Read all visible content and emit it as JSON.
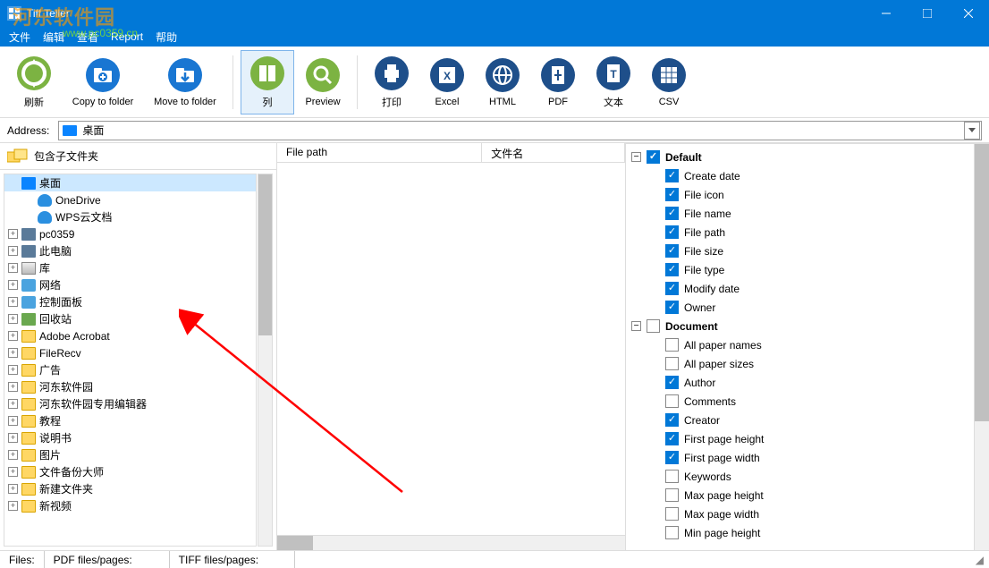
{
  "window": {
    "title": "Tiff Teller"
  },
  "menu": [
    "文件",
    "编辑",
    "查看",
    "Report",
    "帮助"
  ],
  "toolbar": [
    {
      "id": "refresh",
      "label": "刷新",
      "color": "#7cb342",
      "kind": "refresh"
    },
    {
      "id": "copyto",
      "label": "Copy to folder",
      "color": "#1976d2",
      "kind": "folder-plus",
      "wide": true
    },
    {
      "id": "moveto",
      "label": "Move to folder",
      "color": "#1976d2",
      "kind": "folder-down",
      "wide": true
    },
    {
      "sep": true
    },
    {
      "id": "columns",
      "label": "列",
      "color": "#7cb342",
      "kind": "columns",
      "active": true
    },
    {
      "id": "preview",
      "label": "Preview",
      "color": "#7cb342",
      "kind": "search"
    },
    {
      "sep": true
    },
    {
      "id": "print",
      "label": "打印",
      "color": "#1e4f8a",
      "kind": "print"
    },
    {
      "id": "excel",
      "label": "Excel",
      "color": "#1e4f8a",
      "kind": "xls"
    },
    {
      "id": "html",
      "label": "HTML",
      "color": "#1e4f8a",
      "kind": "html"
    },
    {
      "id": "pdf",
      "label": "PDF",
      "color": "#1e4f8a",
      "kind": "pdf"
    },
    {
      "id": "text",
      "label": "文本",
      "color": "#1e4f8a",
      "kind": "txt"
    },
    {
      "id": "csv",
      "label": "CSV",
      "color": "#1e4f8a",
      "kind": "csv"
    }
  ],
  "address": {
    "label": "Address:",
    "value": "桌面"
  },
  "left": {
    "subfolder_label": "包含子文件夹",
    "tree": [
      {
        "label": "桌面",
        "icon": "desktop",
        "selected": true,
        "depth": 0,
        "exp": ""
      },
      {
        "label": "OneDrive",
        "icon": "cloud",
        "depth": 1,
        "exp": ""
      },
      {
        "label": "WPS云文档",
        "icon": "cloud",
        "depth": 1,
        "exp": ""
      },
      {
        "label": "pc0359",
        "icon": "pc",
        "depth": 0,
        "exp": "+"
      },
      {
        "label": "此电脑",
        "icon": "pc",
        "depth": 0,
        "exp": "+"
      },
      {
        "label": "库",
        "icon": "drive",
        "depth": 0,
        "exp": "+"
      },
      {
        "label": "网络",
        "icon": "net",
        "depth": 0,
        "exp": "+"
      },
      {
        "label": "控制面板",
        "icon": "net",
        "depth": 0,
        "exp": "+"
      },
      {
        "label": "回收站",
        "icon": "recycle",
        "depth": 0,
        "exp": "+"
      },
      {
        "label": "Adobe Acrobat",
        "icon": "folder",
        "depth": 0,
        "exp": "+"
      },
      {
        "label": "FileRecv",
        "icon": "folder",
        "depth": 0,
        "exp": "+"
      },
      {
        "label": "广告",
        "icon": "folder",
        "depth": 0,
        "exp": "+"
      },
      {
        "label": "河东软件园",
        "icon": "folder",
        "depth": 0,
        "exp": "+"
      },
      {
        "label": "河东软件园专用编辑器",
        "icon": "folder",
        "depth": 0,
        "exp": "+"
      },
      {
        "label": "教程",
        "icon": "folder",
        "depth": 0,
        "exp": "+"
      },
      {
        "label": "说明书",
        "icon": "folder",
        "depth": 0,
        "exp": "+"
      },
      {
        "label": "图片",
        "icon": "folder",
        "depth": 0,
        "exp": "+"
      },
      {
        "label": "文件备份大师",
        "icon": "folder",
        "depth": 0,
        "exp": "+"
      },
      {
        "label": "新建文件夹",
        "icon": "folder",
        "depth": 0,
        "exp": "+"
      },
      {
        "label": "新视频",
        "icon": "folder",
        "depth": 0,
        "exp": "+"
      }
    ]
  },
  "list": {
    "col1": "File path",
    "col2": "文件名"
  },
  "right": {
    "groups": [
      {
        "label": "Default",
        "checked": true,
        "items": [
          {
            "label": "Create date",
            "checked": true
          },
          {
            "label": "File icon",
            "checked": true
          },
          {
            "label": "File name",
            "checked": true
          },
          {
            "label": "File path",
            "checked": true
          },
          {
            "label": "File size",
            "checked": true
          },
          {
            "label": "File type",
            "checked": true
          },
          {
            "label": "Modify date",
            "checked": true
          },
          {
            "label": "Owner",
            "checked": true
          }
        ]
      },
      {
        "label": "Document",
        "checked": false,
        "items": [
          {
            "label": "All paper names",
            "checked": false
          },
          {
            "label": "All paper sizes",
            "checked": false
          },
          {
            "label": "Author",
            "checked": true
          },
          {
            "label": "Comments",
            "checked": false
          },
          {
            "label": "Creator",
            "checked": true
          },
          {
            "label": "First page height",
            "checked": true
          },
          {
            "label": "First page width",
            "checked": true
          },
          {
            "label": "Keywords",
            "checked": false
          },
          {
            "label": "Max page height",
            "checked": false
          },
          {
            "label": "Max page width",
            "checked": false
          },
          {
            "label": "Min page height",
            "checked": false
          }
        ]
      }
    ]
  },
  "status": {
    "files": "Files:",
    "pdf": "PDF files/pages:",
    "tiff": "TIFF files/pages:"
  },
  "watermark": {
    "l1": "河东软件园",
    "l2": "www.pc0359.cn"
  }
}
